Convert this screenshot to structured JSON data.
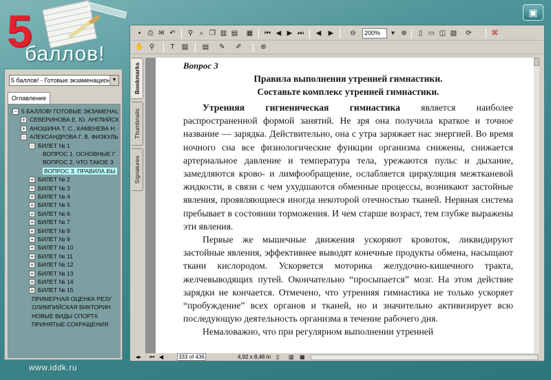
{
  "brand": {
    "logo_number": "5",
    "logo_word": "баллов!",
    "site_url": "www.iddk.ru"
  },
  "left_panel": {
    "collection_select": "5 баллов! - Готовые экзаменацион",
    "tab_label": "Оглавление",
    "tree": [
      {
        "level": 0,
        "expander": "−",
        "label": "5 БАЛЛОВ! ГОТОВЫЕ ЭКЗАМЕНАЦИ"
      },
      {
        "level": 1,
        "expander": "+",
        "label": "СЕВЕРИНОВА Е. Ю. АНГЛИЙСКИ"
      },
      {
        "level": 1,
        "expander": "+",
        "label": "АНОШИНА Т. С., КАМЕНЕВА Н. С"
      },
      {
        "level": 1,
        "expander": "−",
        "label": "АЛЕКСАНДРОВА Г. В. ФИЗКУЛЬ"
      },
      {
        "level": 2,
        "expander": "−",
        "label": "БИЛЕТ № 1"
      },
      {
        "level": 3,
        "expander": "",
        "label": "ВОПРОС 1. ОСНОВНЫЕ Г"
      },
      {
        "level": 3,
        "expander": "",
        "label": "ВОПРОС 2. ЧТО ТАКОЕ З"
      },
      {
        "level": 3,
        "expander": "",
        "label": "ВОПРОС 3. ПРАВИЛА ВЫ",
        "selected": true
      },
      {
        "level": 2,
        "expander": "+",
        "label": "БИЛЕТ № 2"
      },
      {
        "level": 2,
        "expander": "+",
        "label": "БИЛЕТ № 3"
      },
      {
        "level": 2,
        "expander": "+",
        "label": "БИЛЕТ № 4"
      },
      {
        "level": 2,
        "expander": "+",
        "label": "БИЛЕТ № 5"
      },
      {
        "level": 2,
        "expander": "+",
        "label": "БИЛЕТ № 6"
      },
      {
        "level": 2,
        "expander": "+",
        "label": "БИЛЕТ № 7"
      },
      {
        "level": 2,
        "expander": "+",
        "label": "БИЛЕТ № 8"
      },
      {
        "level": 2,
        "expander": "+",
        "label": "БИЛЕТ № 9"
      },
      {
        "level": 2,
        "expander": "+",
        "label": "БИЛЕТ № 10"
      },
      {
        "level": 2,
        "expander": "+",
        "label": "БИЛЕТ № 11"
      },
      {
        "level": 2,
        "expander": "+",
        "label": "БИЛЕТ № 12"
      },
      {
        "level": 2,
        "expander": "+",
        "label": "БИЛЕТ № 13"
      },
      {
        "level": 2,
        "expander": "+",
        "label": "БИЛЕТ № 14"
      },
      {
        "level": 2,
        "expander": "+",
        "label": "БИЛЕТ № 15"
      },
      {
        "level": 2,
        "expander": "",
        "label": "ПРИМЕРНАЯ ОЦЕНКА РЕЗУ"
      },
      {
        "level": 2,
        "expander": "",
        "label": "ОЛИМПИЙСКАЯ ВИКТОРИН"
      },
      {
        "level": 2,
        "expander": "",
        "label": "НОВЫЕ ВИДЫ СПОРТА"
      },
      {
        "level": 2,
        "expander": "",
        "label": "ПРИНЯТЫЕ СОКРАЩЕНИЯ"
      }
    ]
  },
  "viewer": {
    "zoom": "200%",
    "side_tabs": [
      "Bookmarks",
      "Thumbnails",
      "Signatures"
    ],
    "status": {
      "page_of": "333 of 436",
      "page_size": "4,92 x 8,46 in"
    }
  },
  "document": {
    "question_label": "Вопрос 3",
    "title_line1": "Правила выполнения утренней гимнастики.",
    "title_line2": "Составьте комплекс утренней гимнастики.",
    "p1_bold": "Утренняя гигиеническая гимнастика",
    "p1_rest": " является наиболее распространенной формой занятий. Не зря она получила краткое и точное название — зарядка. Действительно, она с утра заряжает нас энергией. Во время ночного сна все физиологические функции организма снижены, снижается артериальное давление и температура тела, урежаются пульс и дыхание, замедляются крово- и лимфообращение, ослабляется циркуляция межтканевой жидкости, в связи с чем ухудшаются обменные процессы, возникают застойные явления, проявляющиеся иногда некоторой отечностью тканей. Нервная система пребывает в состоянии торможения. И чем старше возраст, тем глубже выражены эти явления.",
    "p2": "Первые же мышечные движения ускоряют кровоток, ликвидируют застойные явления, эффективнее выводят конечные продукты обмена, насыщают ткани кислородом. Ускоряется моторика желудочно-кишечного тракта, желчевыводящих путей. Окончательно “просыпается” мозг. На этом действие зарядки не кончается. Отмечено, что утренняя гимнастика не только ускоряет “пробуждение” всех органов и тканей, но и значительно активизирует всю последующую деятельность организма в течение рабочего дня.",
    "p3_partial": "Немаловажно, что при регулярном выполнении утренней"
  }
}
